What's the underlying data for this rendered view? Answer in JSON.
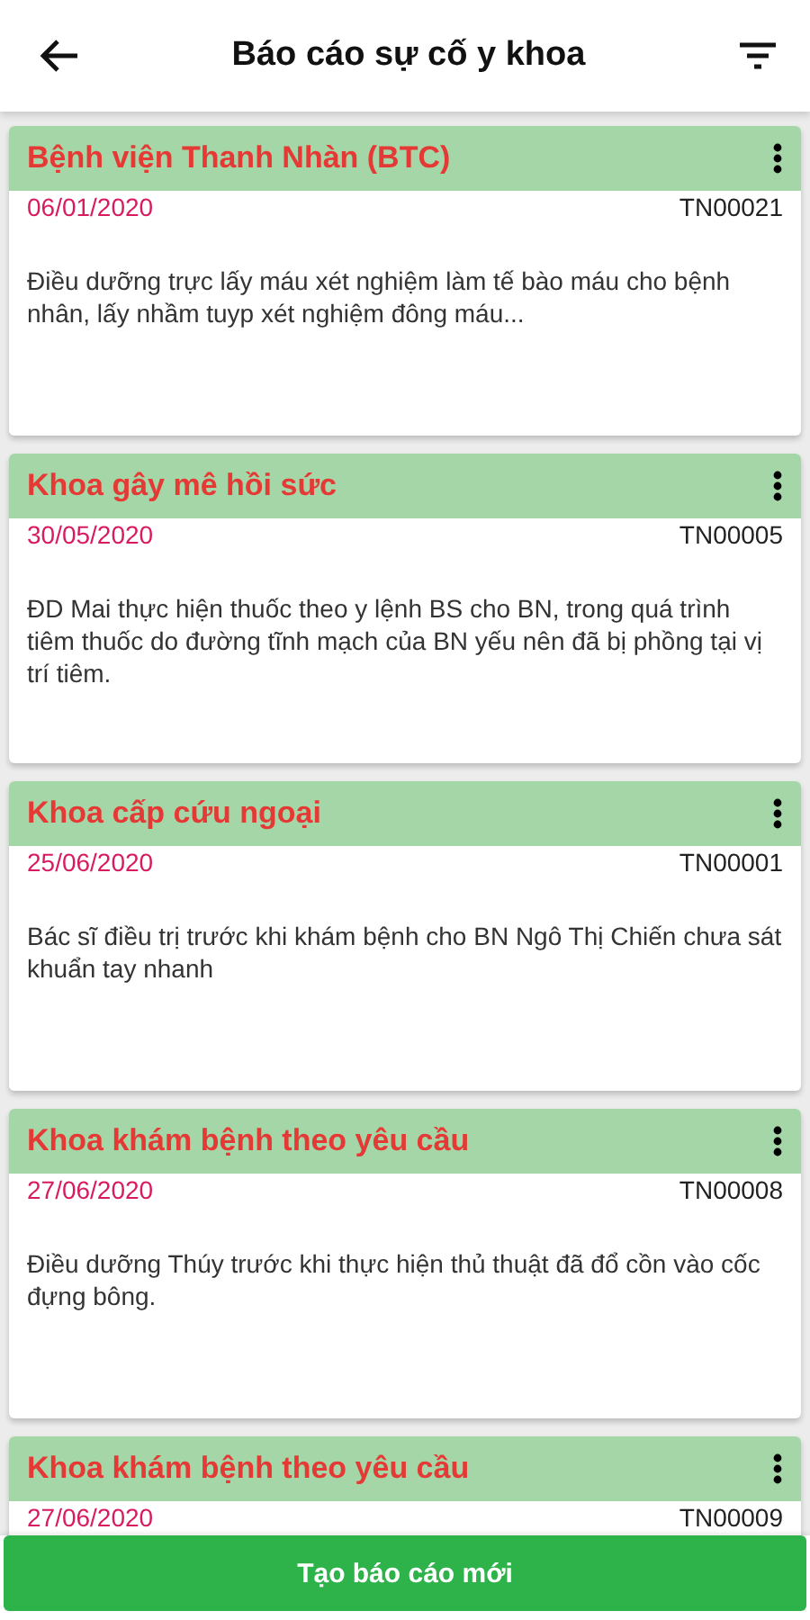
{
  "header": {
    "title": "Báo cáo sự cố y khoa"
  },
  "reports": [
    {
      "department": "Bệnh viện Thanh Nhàn (BTC)",
      "date": "06/01/2020",
      "code": "TN00021",
      "description": "Điều dưỡng trực lấy máu xét nghiệm làm tế bào máu cho bệnh nhân, lấy nhầm tuyp xét nghiệm đông máu..."
    },
    {
      "department": "Khoa gây mê hồi sức",
      "date": "30/05/2020",
      "code": "TN00005",
      "description": "ĐD Mai thực hiện thuốc theo y lệnh BS cho BN, trong quá trình tiêm thuốc do đường tĩnh mạch của BN yếu nên đã bị phồng tại vị trí tiêm."
    },
    {
      "department": "Khoa cấp cứu ngoại",
      "date": "25/06/2020",
      "code": "TN00001",
      "description": "Bác sĩ điều trị trước khi khám bệnh cho BN Ngô Thị Chiến chưa sát khuẩn tay nhanh"
    },
    {
      "department": "Khoa khám bệnh theo yêu cầu",
      "date": "27/06/2020",
      "code": "TN00008",
      "description": "Điều dưỡng Thúy trước khi thực hiện thủ thuật đã đổ cồn vào cốc đựng bông."
    },
    {
      "department": "Khoa khám bệnh theo yêu cầu",
      "date": "27/06/2020",
      "code": "TN00009"
    }
  ],
  "create_button": "Tạo báo cáo mới"
}
